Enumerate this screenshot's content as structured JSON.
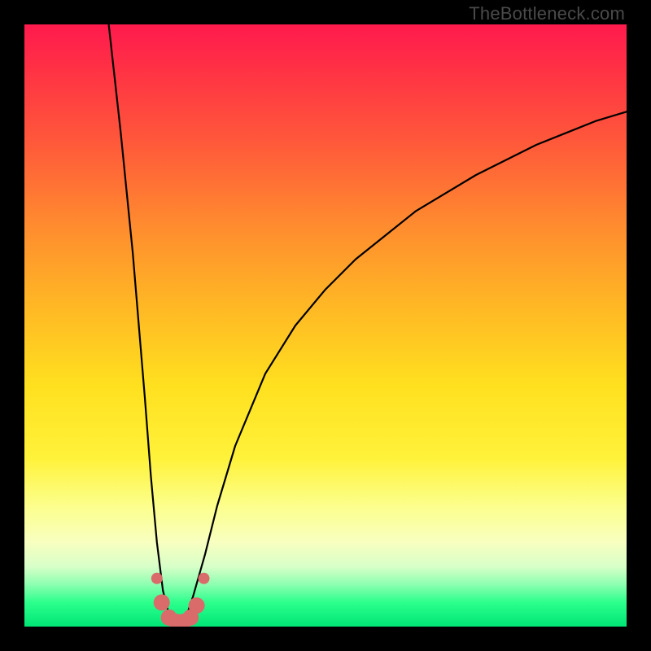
{
  "watermark": "TheBottleneck.com",
  "chart_data": {
    "type": "line",
    "title": "",
    "xlabel": "",
    "ylabel": "",
    "xlim": [
      0,
      100
    ],
    "ylim": [
      0,
      100
    ],
    "background_gradient_meaning": "bottleneck severity (red=high, green=none)",
    "series": [
      {
        "name": "bottleneck-curve",
        "x": [
          14,
          16,
          18,
          19,
          20,
          21,
          22,
          23,
          24,
          25,
          26,
          27,
          28,
          30,
          32,
          35,
          40,
          45,
          50,
          55,
          60,
          65,
          70,
          75,
          80,
          85,
          90,
          95,
          100
        ],
        "y": [
          100,
          82,
          62,
          50,
          38,
          25,
          14,
          6,
          2,
          0,
          0,
          2,
          5,
          12,
          20,
          30,
          42,
          50,
          56,
          61,
          65,
          69,
          72,
          75,
          77.5,
          80,
          82,
          84,
          85.5
        ]
      }
    ],
    "markers": {
      "name": "highlight-dots",
      "color": "#d96b6b",
      "points": [
        {
          "x": 22.0,
          "y": 8
        },
        {
          "x": 22.8,
          "y": 4
        },
        {
          "x": 24.0,
          "y": 1.5
        },
        {
          "x": 25.2,
          "y": 0.8
        },
        {
          "x": 26.4,
          "y": 0.8
        },
        {
          "x": 27.6,
          "y": 1.5
        },
        {
          "x": 28.6,
          "y": 3.5
        },
        {
          "x": 29.8,
          "y": 8
        }
      ]
    }
  }
}
